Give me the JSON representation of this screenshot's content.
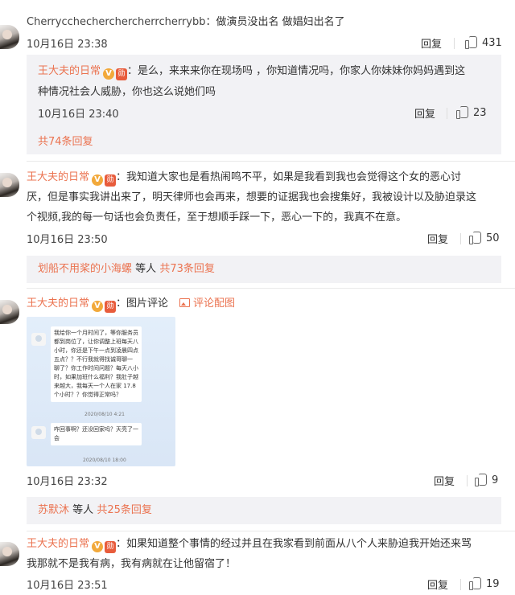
{
  "comments": [
    {
      "user": "Cherrycchecherchercherrcherrybb",
      "text": "做演员没出名 做娼妇出名了",
      "time": "10月16日 23:38",
      "reply": "回复",
      "likes": "431"
    },
    {
      "reply_to_first": {
        "user": "王大夫的日常",
        "line1": "是么，来来来你在现场吗 ，你知道情况吗，你家人你妹妹你妈妈遇到这",
        "line2": "种情况社会人威胁，你也这么说她们吗",
        "time": "10月16日 23:40",
        "reply": "回复",
        "likes": "23"
      },
      "more": "共74条回复"
    },
    {
      "user": "王大夫的日常",
      "line1": "我知道大家也是看热闹鸣不平，如果是我看到我也会觉得这个女的恶心讨",
      "line2": "厌，但是事实我讲出来了，明天律师也会再来，想要的证据我也会搜集好，我被设计以及胁迫录这",
      "line3": "个视频,我的每一句话也会负责任，至于想顺手踩一下，恶心一下的，我真不在意。",
      "time": "10月16日 23:50",
      "reply": "回复",
      "likes": "50",
      "sub_users": "划船不用桨的小海螺",
      "sub_mid": "等人",
      "sub_more": "共73条回复"
    },
    {
      "user": "王大夫的日常",
      "text": "图片评论",
      "image_link": "评论配图",
      "time": "10月16日 23:32",
      "reply": "回复",
      "likes": "9",
      "sub_users": "苏默沐",
      "sub_mid": "等人",
      "sub_more": "共25条回复",
      "chat": {
        "msg1": "我给你一个月时间了，等你服务员\n都到岗位了，让你调整上班每天八\n小时，你还是下午一点到凌晨四点\n五点？？不行我就得找诚哥聊一\n聊了？你工作时间问题？每天八小\n时，如果加班什么福利？我肚子越\n来越大，我每天一个人在家 17.8\n个小时？？你觉得正常吗？",
        "stamp1": "2020/08/10 4:21",
        "msg2": "咋回事啊？还没回家吗？天亮了一\n会",
        "stamp2": "2020/08/10 18:00"
      }
    },
    {
      "user": "王大夫的日常",
      "line1": "如果知道整个事情的经过并且在我家看到前面从八个人来胁迫我开始还来骂",
      "line2": "我那就不是我有病，我有病就在让他留宿了！",
      "time": "10月16日 23:51",
      "reply": "回复",
      "likes": "19"
    }
  ],
  "icons": {
    "verified": "V",
    "medal": "勋",
    "colon": "："
  },
  "colors": {
    "accent": "#eb7350",
    "subbox_bg": "#f2f2f5"
  }
}
